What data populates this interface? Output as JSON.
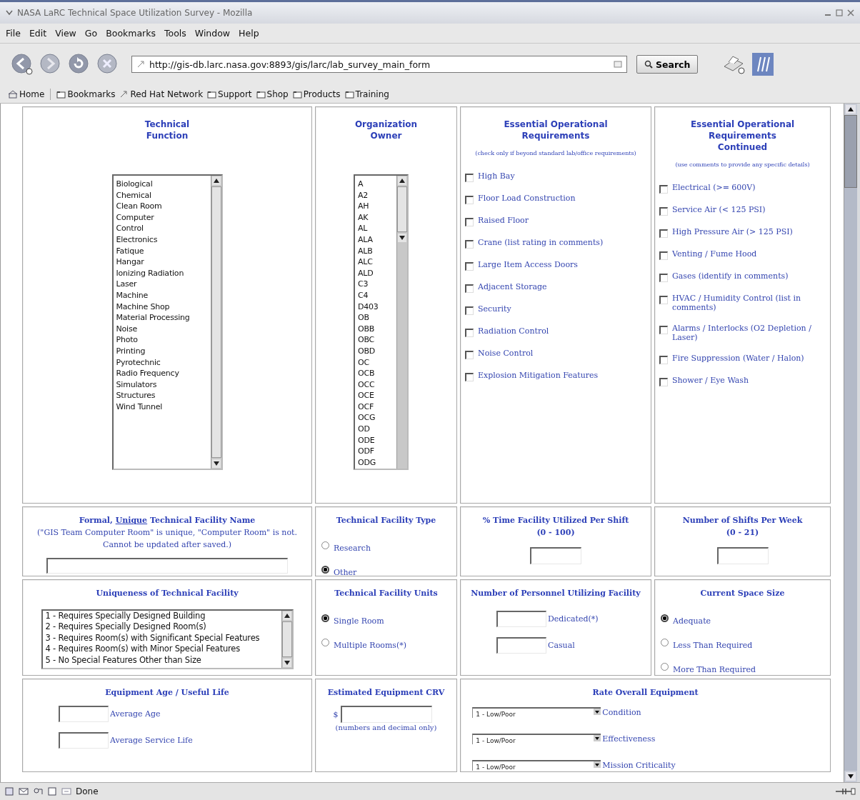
{
  "window": {
    "title": "NASA LaRC Technical Space Utilization Survey - Mozilla"
  },
  "menu": [
    "File",
    "Edit",
    "View",
    "Go",
    "Bookmarks",
    "Tools",
    "Window",
    "Help"
  ],
  "navigation": {
    "url": "http://gis-db.larc.nasa.gov:8893/gis/larc/lab_survey_main_form",
    "search_button": "Search"
  },
  "bookmarks": [
    {
      "label": "Home",
      "kind": "home"
    },
    {
      "label": "Bookmarks",
      "kind": "folder"
    },
    {
      "label": "Red Hat Network",
      "kind": "link"
    },
    {
      "label": "Support",
      "kind": "folder"
    },
    {
      "label": "Shop",
      "kind": "folder"
    },
    {
      "label": "Products",
      "kind": "folder"
    },
    {
      "label": "Training",
      "kind": "folder"
    }
  ],
  "technical_function": {
    "title": [
      "Technical",
      "Function"
    ],
    "items": [
      "Biological",
      "Chemical",
      "Clean Room",
      "Computer",
      "Control",
      "Electronics",
      "Fatique",
      "Hangar",
      "Ionizing Radiation",
      "Laser",
      "Machine",
      "Machine Shop",
      "Material Processing",
      "Noise",
      "Photo",
      "Printing",
      "Pyrotechnic",
      "Radio Frequency",
      "Simulators",
      "Structures",
      "Wind Tunnel"
    ]
  },
  "organization_owner": {
    "title": [
      "Organization",
      "Owner"
    ],
    "items": [
      "A",
      "A2",
      "AH",
      "AK",
      "AL",
      "ALA",
      "ALB",
      "ALC",
      "ALD",
      "C3",
      "C4",
      "D403",
      "OB",
      "OBB",
      "OBC",
      "OBD",
      "OC",
      "OCB",
      "OCC",
      "OCE",
      "OCF",
      "OCG",
      "OD",
      "ODE",
      "ODF",
      "ODG"
    ]
  },
  "requirements": {
    "title": [
      "Essential Operational",
      "Requirements"
    ],
    "note": "(check only if beyond standard lab/office requirements)",
    "items": [
      {
        "label": "High Bay",
        "checked": false
      },
      {
        "label": "Floor Load Construction",
        "checked": false
      },
      {
        "label": "Raised Floor",
        "checked": false
      },
      {
        "label": "Crane (list rating in comments)",
        "checked": false
      },
      {
        "label": "Large Item Access Doors",
        "checked": false
      },
      {
        "label": "Adjacent Storage",
        "checked": false
      },
      {
        "label": "Security",
        "checked": false
      },
      {
        "label": "Radiation Control",
        "checked": false
      },
      {
        "label": "Noise Control",
        "checked": false
      },
      {
        "label": "Explosion Mitigation Features",
        "checked": false
      }
    ]
  },
  "requirements_continued": {
    "title": [
      "Essential Operational",
      "Requirements",
      "Continued"
    ],
    "note": "(use comments to provide any specific details)",
    "items": [
      {
        "label": "Electrical (>= 600V)",
        "checked": false
      },
      {
        "label": "Service Air (< 125 PSI)",
        "checked": false
      },
      {
        "label": "High Pressure Air (> 125 PSI)",
        "checked": false
      },
      {
        "label": "Venting / Fume Hood",
        "checked": false
      },
      {
        "label": "Gases (identify in comments)",
        "checked": false
      },
      {
        "label": "HVAC / Humidity Control (list in comments)",
        "checked": false
      },
      {
        "label": "Alarms / Interlocks (O2 Depletion / Laser)",
        "checked": false
      },
      {
        "label": "Fire Suppression (Water / Halon)",
        "checked": false
      },
      {
        "label": "Shower / Eye Wash",
        "checked": false
      }
    ]
  },
  "facility_name": {
    "title_before": "Formal,",
    "title_link": "Unique",
    "title_after": "Technical Facility Name",
    "note": [
      "(\"GIS Team Computer Room\" is unique, \"Computer Room\" is not.",
      "Cannot be updated after saved.)"
    ]
  },
  "facility_type": {
    "title": "Technical Facility Type",
    "options": [
      {
        "label": "Research",
        "selected": false
      },
      {
        "label": "Other",
        "selected": true
      }
    ]
  },
  "time_utilized": {
    "title": "% Time Facility Utilized Per Shift",
    "range": "(0 - 100)"
  },
  "shifts_per_week": {
    "title": "Number of Shifts Per Week",
    "range": "(0 - 21)"
  },
  "uniqueness": {
    "title": "Uniqueness of Technical Facility",
    "items": [
      "1 - Requires Specially Designed Building",
      "2 - Requires Specially Designed Room(s)",
      "3 - Requires Room(s) with Significant Special Features",
      "4 - Requires Room(s) with Minor Special Features",
      "5 - No Special Features Other than Size"
    ]
  },
  "facility_units": {
    "title": "Technical Facility Units",
    "options": [
      {
        "label": "Single Room",
        "selected": true
      },
      {
        "label": "Multiple Rooms(*)",
        "selected": false
      }
    ]
  },
  "personnel": {
    "title": "Number of Personnel Utilizing Facility",
    "fields": [
      {
        "label": "Dedicated(*)"
      },
      {
        "label": "Casual"
      }
    ]
  },
  "space_size": {
    "title": "Current Space Size",
    "options": [
      {
        "label": "Adequate",
        "selected": true
      },
      {
        "label": "Less Than Required",
        "selected": false
      },
      {
        "label": "More Than Required",
        "selected": false
      }
    ]
  },
  "equipment_age": {
    "title": "Equipment Age / Useful Life",
    "fields": [
      {
        "label": "Average Age"
      },
      {
        "label": "Average Service Life"
      }
    ]
  },
  "equipment_crv": {
    "title": "Estimated Equipment CRV",
    "prefix": "$",
    "note": "(numbers and decimal only)"
  },
  "rate_equipment": {
    "title": "Rate Overall Equipment",
    "selects": [
      {
        "value": "1 - Low/Poor",
        "label": "Condition"
      },
      {
        "value": "1 - Low/Poor",
        "label": "Effectiveness"
      },
      {
        "value": "1 - Low/Poor",
        "label": "Mission Criticality"
      }
    ]
  },
  "status_bar": {
    "text": "Done"
  }
}
